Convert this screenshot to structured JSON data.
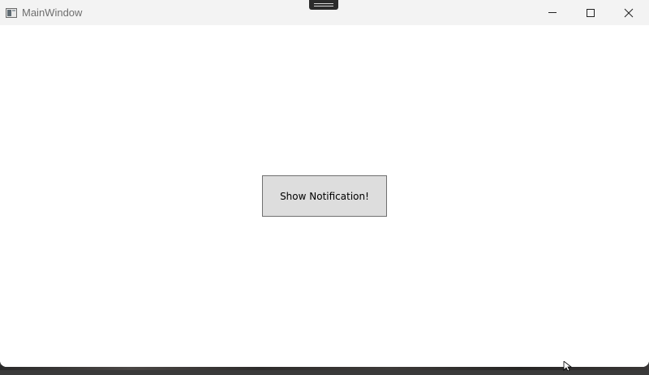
{
  "window": {
    "title": "MainWindow",
    "controls": {
      "minimize_icon": "minimize-icon",
      "maximize_icon": "maximize-icon",
      "close_icon": "close-icon"
    }
  },
  "main": {
    "button_label": "Show Notification!"
  },
  "colors": {
    "titlebar_bg": "#f3f3f3",
    "client_bg": "#ffffff",
    "button_bg": "#dddddd",
    "button_border": "#707070",
    "title_text": "#6e6e6e"
  }
}
